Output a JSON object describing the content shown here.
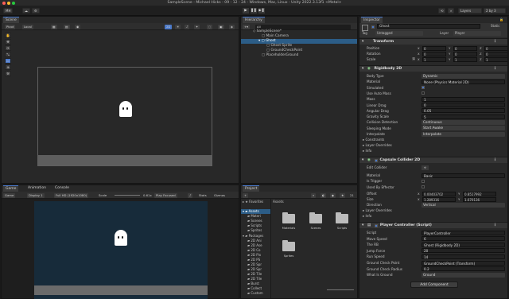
{
  "window": {
    "title": "SampleScene - Michael Hicks - 09 - 12 - 24 - Windows, Mac, Linux - Unity 2022.3.13f1 <Metal>"
  },
  "toolbar": {
    "account": "MH",
    "layers": "Layers",
    "layout": "2 by 3"
  },
  "scene": {
    "tab": "Scene",
    "pivot": "Pivot",
    "local": "Local",
    "mode2d": "2D",
    "tools": [
      "hand-icon",
      "move-icon",
      "rotate-icon",
      "scale-icon",
      "rect-icon",
      "transform-icon",
      "custom-icon"
    ]
  },
  "game": {
    "tabs": [
      "Game",
      "Animation",
      "Console"
    ],
    "view": "Game",
    "display": "Display 1",
    "resolution": "Full HD (1920x1080)",
    "scale_label": "Scale",
    "scale_value": "0.61x",
    "play_mode": "Play Focused",
    "stats": "Stats",
    "gizmos": "Gizmos"
  },
  "hierarchy": {
    "tab": "Hierarchy",
    "search_placeholder": "All",
    "items": [
      {
        "label": "SampleScene*",
        "depth": 0
      },
      {
        "label": "Main Camera",
        "depth": 1
      },
      {
        "label": "Ghost",
        "depth": 1,
        "selected": true
      },
      {
        "label": "Ghost Sprite",
        "depth": 2
      },
      {
        "label": "GroundCheckPoint",
        "depth": 2
      },
      {
        "label": "PlaceholderGround",
        "depth": 1
      }
    ]
  },
  "project": {
    "tab": "Project",
    "add": "+",
    "count": "21",
    "favorites": "Favorites",
    "breadcrumb": "Assets",
    "tree": [
      {
        "label": "Assets",
        "depth": 0,
        "selected": true
      },
      {
        "label": "Materi",
        "depth": 1
      },
      {
        "label": "Scenes",
        "depth": 1
      },
      {
        "label": "Scripts",
        "depth": 1
      },
      {
        "label": "Sprites",
        "depth": 1
      },
      {
        "label": "Packages",
        "depth": 0
      },
      {
        "label": "2D Ani",
        "depth": 1
      },
      {
        "label": "2D Ase",
        "depth": 1
      },
      {
        "label": "2D Co",
        "depth": 1
      },
      {
        "label": "2D Pix",
        "depth": 1
      },
      {
        "label": "2D PS",
        "depth": 1
      },
      {
        "label": "2D Spr",
        "depth": 1
      },
      {
        "label": "2D Spr",
        "depth": 1
      },
      {
        "label": "2D Tile",
        "depth": 1
      },
      {
        "label": "2D Tile",
        "depth": 1
      },
      {
        "label": "Burst",
        "depth": 1
      },
      {
        "label": "Collect",
        "depth": 1
      },
      {
        "label": "Custom",
        "depth": 1
      }
    ],
    "folders": [
      "Materials",
      "Scenes",
      "Scripts",
      "Sprites"
    ]
  },
  "inspector": {
    "tab": "Inspector",
    "object_name": "Ghost",
    "static": "Static",
    "tag_label": "Tag",
    "tag": "Untagged",
    "layer_label": "Layer",
    "layer": "Player",
    "transform": {
      "title": "Transform",
      "position": {
        "label": "Position",
        "x": "0",
        "y": "0",
        "z": "0"
      },
      "rotation": {
        "label": "Rotation",
        "x": "0",
        "y": "0",
        "z": "0"
      },
      "scale": {
        "label": "Scale",
        "x": "1",
        "y": "1",
        "z": "1"
      }
    },
    "rigidbody": {
      "title": "Rigidbody 2D",
      "rows": [
        {
          "label": "Body Type",
          "value": "Dynamic",
          "kind": "dropdown"
        },
        {
          "label": "Material",
          "value": "None (Physics Material 2D)",
          "kind": "field"
        },
        {
          "label": "Simulated",
          "value": "",
          "kind": "check-on"
        },
        {
          "label": "Use Auto Mass",
          "value": "",
          "kind": "check-off"
        },
        {
          "label": "Mass",
          "value": "1",
          "kind": "field"
        },
        {
          "label": "Linear Drag",
          "value": "0",
          "kind": "field"
        },
        {
          "label": "Angular Drag",
          "value": "0.05",
          "kind": "field"
        },
        {
          "label": "Gravity Scale",
          "value": "5",
          "kind": "field"
        },
        {
          "label": "Collision Detection",
          "value": "Continuous",
          "kind": "dropdown"
        },
        {
          "label": "Sleeping Mode",
          "value": "Start Awake",
          "kind": "dropdown"
        },
        {
          "label": "Interpolate",
          "value": "Interpolate",
          "kind": "dropdown"
        }
      ],
      "foldouts": [
        "Constraints",
        "Layer Overrides",
        "Info"
      ]
    },
    "capsule": {
      "title": "Capsule Collider 2D",
      "edit_collider": "Edit Collider",
      "rows": [
        {
          "label": "Material",
          "value": "Basic",
          "kind": "field"
        },
        {
          "label": "Is Trigger",
          "value": "",
          "kind": "check-off"
        },
        {
          "label": "Used By Effector",
          "value": "",
          "kind": "check-off"
        }
      ],
      "offset": {
        "label": "Offset",
        "x": "0.00403702",
        "y": "0.8517992"
      },
      "size": {
        "label": "Size",
        "x": "1.289316",
        "y": "1.670136"
      },
      "direction": {
        "label": "Direction",
        "value": "Vertical"
      },
      "foldouts": [
        "Layer Overrides",
        "Info"
      ]
    },
    "player": {
      "title": "Player Controller (Script)",
      "rows": [
        {
          "label": "Script",
          "value": "PlayerController",
          "kind": "field"
        },
        {
          "label": "Move Speed",
          "value": "6",
          "kind": "field"
        },
        {
          "label": "The RB",
          "value": "Ghost (Rigidbody 2D)",
          "kind": "field"
        },
        {
          "label": "Jump Force",
          "value": "20",
          "kind": "field"
        },
        {
          "label": "Run Speed",
          "value": "14",
          "kind": "field"
        },
        {
          "label": "Ground Check Point",
          "value": "GroundCheckPoint (Transform)",
          "kind": "field"
        },
        {
          "label": "Ground Check Radius",
          "value": "0.2",
          "kind": "field"
        },
        {
          "label": "What Is Ground",
          "value": "Ground",
          "kind": "dropdown"
        }
      ]
    },
    "add_component": "Add Component"
  },
  "colors": {
    "accent": "#4a78c8",
    "selected_row": "#2c5d87",
    "game_bg": "#172b3a"
  }
}
